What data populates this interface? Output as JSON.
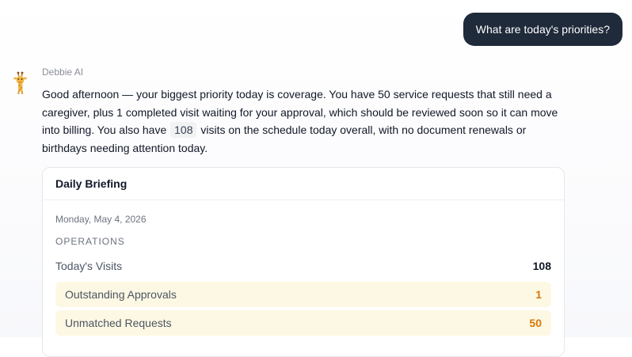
{
  "user_message": "What are today's priorities?",
  "assistant": {
    "name": "Debbie AI",
    "avatar_icon": "giraffe-icon",
    "message_part1": "Good afternoon — your biggest priority today is coverage. You have 50 service requests that still need a caregiver, plus 1 completed visit waiting for your approval, which should be reviewed soon so it can move into billing. You also have ",
    "message_highlight": "108",
    "message_part2": " visits on the schedule today overall, with no document renewals or birthdays needing attention today."
  },
  "briefing": {
    "title": "Daily Briefing",
    "date": "Monday, May 4, 2026",
    "section": "OPERATIONS",
    "metrics": [
      {
        "label": "Today's Visits",
        "value": "108"
      },
      {
        "label": "Outstanding Approvals",
        "value": "1"
      },
      {
        "label": "Unmatched Requests",
        "value": "50"
      }
    ]
  },
  "colors": {
    "user_bubble": "#1f2a3a",
    "warning_bg": "#fdf8e3",
    "warning_text": "#d97706"
  }
}
